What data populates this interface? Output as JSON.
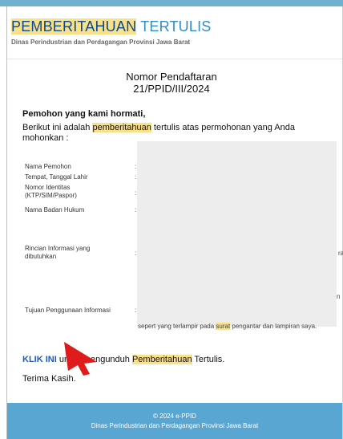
{
  "header": {
    "title_part1": "PEMBERITAHUAN",
    "title_part2": "TERTULIS",
    "subtitle": "Dinas Perindustrian dan Perdagangan Provinsi Jawa Barat"
  },
  "registration": {
    "label": "Nomor Pendaftaran",
    "number": "21/PPID/III/2024"
  },
  "greeting": "Pemohon yang kami hormati,",
  "intro": {
    "before": "Berikut ini adalah ",
    "highlight": "pemberitahuan",
    "after": " tertulis atas permohonan yang Anda mohonkan :"
  },
  "fields": [
    {
      "label": "Nama Pemohon",
      "colon": ":"
    },
    {
      "label": "Tempat, Tanggal Lahir",
      "colon": ":"
    },
    {
      "label": "Nomor Identitas (KTP/SIM/Paspor)",
      "colon": ":"
    },
    {
      "label": "Nama Badan Hukum",
      "colon": ":"
    },
    {
      "label": "Rincian Informasi yang dibutuhkan",
      "colon": ":"
    },
    {
      "label": "Tujuan Penggunaan Informasi",
      "colon": ":"
    }
  ],
  "partial_text": {
    "fragment1": "ra",
    "fragment2": "n",
    "bottom_line_before": "sepert yang terlampir pada ",
    "bottom_line_highlight": "surat",
    "bottom_line_after": " pengantar dan lampiran saya."
  },
  "download": {
    "link_label": "KLIK INI",
    "text_before": " untuk mengunduh ",
    "highlight": "Pemberitahuan",
    "text_after": " Tertulis."
  },
  "thanks": "Terima Kasih.",
  "footer": {
    "copyright": "© 2024 e-PPID",
    "org": "Dinas Perindustrian dan Perdagangan Provinsi Jawa Barat"
  },
  "colors": {
    "highlight": "#fbe08a",
    "title_dark": "#0b4a8b",
    "title_light": "#2f8dc7",
    "footer_bg": "#5aa6d3",
    "link": "#1e5bb8",
    "pointer": "#e01b1b"
  },
  "icons": {
    "pointer": "red-arrow-pointer-icon"
  }
}
